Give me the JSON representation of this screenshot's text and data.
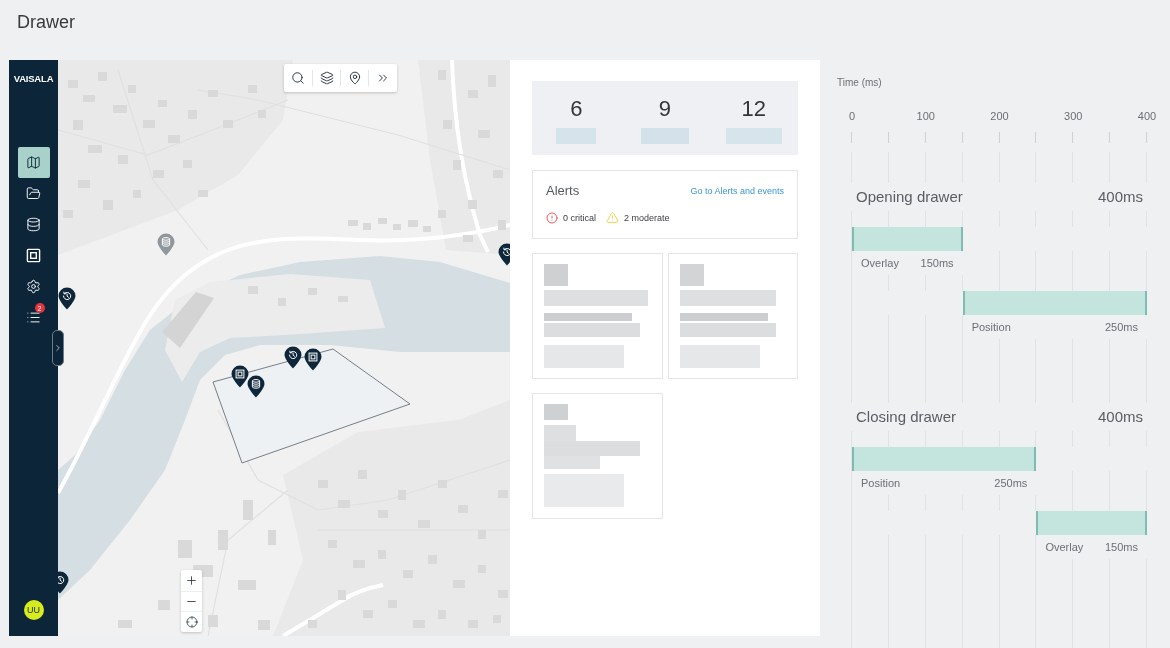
{
  "page": {
    "title": "Drawer"
  },
  "sidebar": {
    "logo": "VAISALA",
    "items": [
      {
        "selected": true
      },
      {
        "selected": false
      },
      {
        "selected": false
      },
      {
        "selected": false
      },
      {
        "selected": false
      },
      {
        "selected": false,
        "badge": "2"
      }
    ],
    "avatar": "UU"
  },
  "summary": {
    "stats": [
      {
        "value": "6"
      },
      {
        "value": "9"
      },
      {
        "value": "12"
      }
    ]
  },
  "alerts": {
    "title": "Alerts",
    "link": "Go to Alerts and events",
    "counts": [
      {
        "kind": "critical",
        "text": "0 critical"
      },
      {
        "kind": "moderate",
        "text": "2 moderate"
      }
    ]
  },
  "timeline": {
    "axis": {
      "title": "Time (ms)",
      "ticks": [
        "0",
        "100",
        "200",
        "300",
        "400"
      ]
    },
    "groups": [
      {
        "title": "Opening drawer",
        "total": "400ms",
        "phases": [
          {
            "label": "Overlay",
            "duration": "150ms",
            "level": 0.375
          },
          {
            "label": "Position",
            "duration": "250ms",
            "level": 0.625
          }
        ]
      },
      {
        "title": "Closing drawer",
        "total": "400ms",
        "phases": [
          {
            "label": "Position",
            "duration": "250ms",
            "level": 0.625
          },
          {
            "label": "Overlay",
            "duration": "150ms",
            "level": 0.375
          }
        ]
      }
    ]
  }
}
